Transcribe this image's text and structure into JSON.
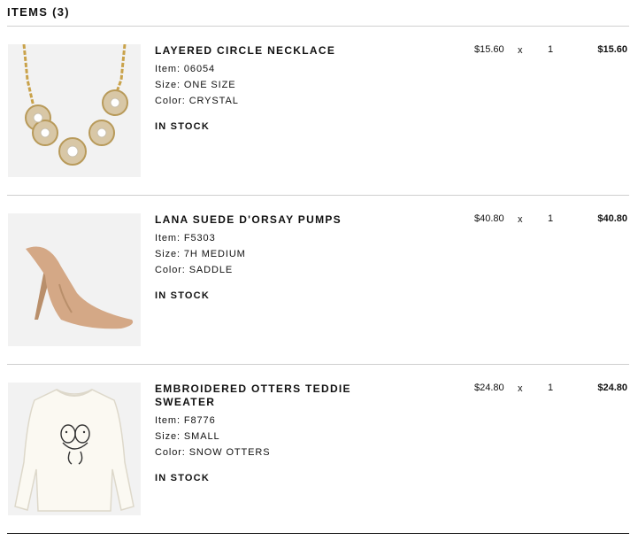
{
  "header": {
    "title": "ITEMS (3)"
  },
  "items": [
    {
      "name": "LAYERED CIRCLE NECKLACE",
      "item": "Item: 06054",
      "size": "Size: ONE SIZE",
      "color": "Color: CRYSTAL",
      "stock": "IN STOCK",
      "price": "$15.60",
      "times": "x",
      "qty": "1",
      "total": "$15.60",
      "image": "necklace-image"
    },
    {
      "name": "LANA SUEDE D'ORSAY PUMPS",
      "item": "Item: F5303",
      "size": "Size: 7H MEDIUM",
      "color": "Color: SADDLE",
      "stock": "IN STOCK",
      "price": "$40.80",
      "times": "x",
      "qty": "1",
      "total": "$40.80",
      "image": "pumps-image"
    },
    {
      "name": "EMBROIDERED OTTERS TEDDIE SWEATER",
      "item": "Item: F8776",
      "size": "Size: SMALL",
      "color": "Color: SNOW OTTERS",
      "stock": "IN STOCK",
      "price": "$24.80",
      "times": "x",
      "qty": "1",
      "total": "$24.80",
      "image": "sweater-image"
    }
  ]
}
